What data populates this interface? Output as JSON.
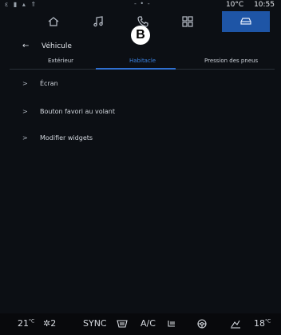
{
  "status": {
    "left_icons": "ε ▮ ▴ ⇑",
    "center_icons": "- • -",
    "temperature": "10°C",
    "time": "10:55"
  },
  "topnav": {
    "items": [
      {
        "icon": "home-icon"
      },
      {
        "icon": "music-icon"
      },
      {
        "icon": "phone-icon"
      },
      {
        "icon": "apps-icon"
      },
      {
        "icon": "car-icon",
        "active": true
      }
    ]
  },
  "marker": {
    "label": "B"
  },
  "header": {
    "back": "←",
    "title": "Véhicule"
  },
  "tabs": {
    "items": [
      "Extérieur",
      "Habitacle",
      "Pression des pneus"
    ],
    "active_index": 1
  },
  "list": {
    "items": [
      {
        "chevron": ">",
        "label": "Écran"
      },
      {
        "chevron": ">",
        "label": "Bouton favori au volant"
      },
      {
        "chevron": ">",
        "label": "Modifier widgets"
      }
    ]
  },
  "bottombar": {
    "temp_left": "21",
    "temp_left_unit": "°C",
    "fan": "2",
    "sync": "SYNC",
    "ac": "A/C",
    "temp_right": "18",
    "temp_right_unit": "°C"
  },
  "colors": {
    "background": "#0c0f14",
    "accent": "#1e55a6",
    "tab_active": "#3b82e0"
  }
}
